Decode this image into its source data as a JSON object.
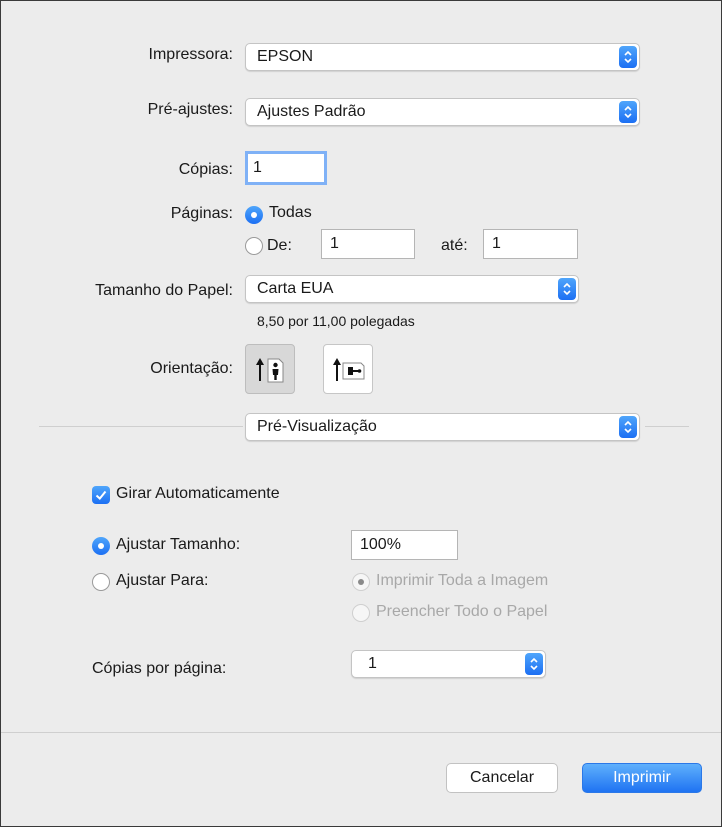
{
  "printer": {
    "label": "Impressora:",
    "value": "EPSON"
  },
  "presets": {
    "label": "Pré-ajustes:",
    "value": "Ajustes Padrão"
  },
  "copies": {
    "label": "Cópias:",
    "value": "1"
  },
  "pages": {
    "label": "Páginas:",
    "all_label": "Todas",
    "from_label": "De:",
    "from_value": "1",
    "to_label": "até:",
    "to_value": "1"
  },
  "paper_size": {
    "label": "Tamanho do Papel:",
    "value": "Carta EUA",
    "dimensions": "8,50 por 11,00 polegadas"
  },
  "orientation": {
    "label": "Orientação:",
    "selected": "portrait"
  },
  "section_popup": {
    "value": "Pré-Visualização"
  },
  "auto_rotate": {
    "label": "Girar Automaticamente",
    "checked": true
  },
  "scale": {
    "label": "Ajustar Tamanho:",
    "value": "100%"
  },
  "fit": {
    "label": "Ajustar Para:",
    "option_all_image": "Imprimir Toda a Imagem",
    "option_fill_paper": "Preencher Todo o Papel"
  },
  "copies_per_page": {
    "label": "Cópias por página:",
    "value": "1"
  },
  "buttons": {
    "cancel": "Cancelar",
    "print": "Imprimir"
  },
  "colors": {
    "accent": "#1c6ff3",
    "background": "#ececec"
  }
}
